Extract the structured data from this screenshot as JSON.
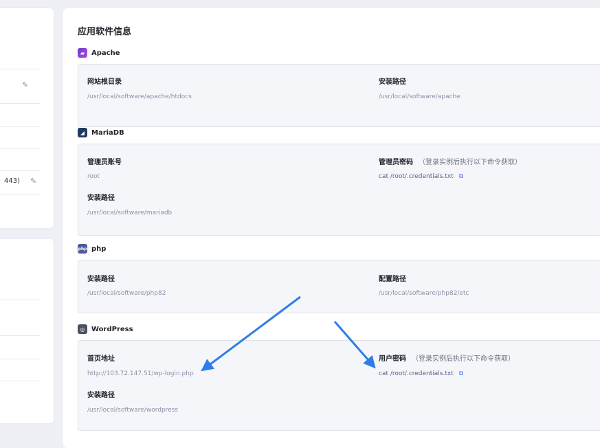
{
  "main": {
    "title": "应用软件信息"
  },
  "left_card": {
    "port_text": "443)"
  },
  "apache": {
    "name": "Apache",
    "docroot_label": "网站根目录",
    "docroot_value": "/usr/local/software/apache/htdocs",
    "install_label": "安装路径",
    "install_value": "/usr/local/software/apache"
  },
  "mariadb": {
    "name": "MariaDB",
    "admin_label": "管理员账号",
    "admin_value": "root",
    "password_label": "管理员密码",
    "password_note": "（登录实例后执行以下命令获取）",
    "password_value": "cat /root/.credentials.txt",
    "install_label": "安装路径",
    "install_value": "/usr/local/software/mariadb"
  },
  "php": {
    "name": "php",
    "install_label": "安装路径",
    "install_value": "/usr/local/software/php82",
    "config_label": "配置路径",
    "config_value": "/usr/local/software/php82/etc"
  },
  "wordpress": {
    "name": "WordPress",
    "home_label": "首页地址",
    "home_value": "http://103.72.147.51/wp-login.php",
    "password_label": "用户密码",
    "password_note": "（登录实例后执行以下命令获取）",
    "password_value": "cat /root/.credentials.txt",
    "install_label": "安装路径",
    "install_value": "/usr/local/software/wordpress"
  },
  "icons": {
    "edit": "edit-icon",
    "copy": "copy-icon"
  },
  "colors": {
    "arrow": "#2f7de8",
    "link": "#3b6ef5"
  }
}
